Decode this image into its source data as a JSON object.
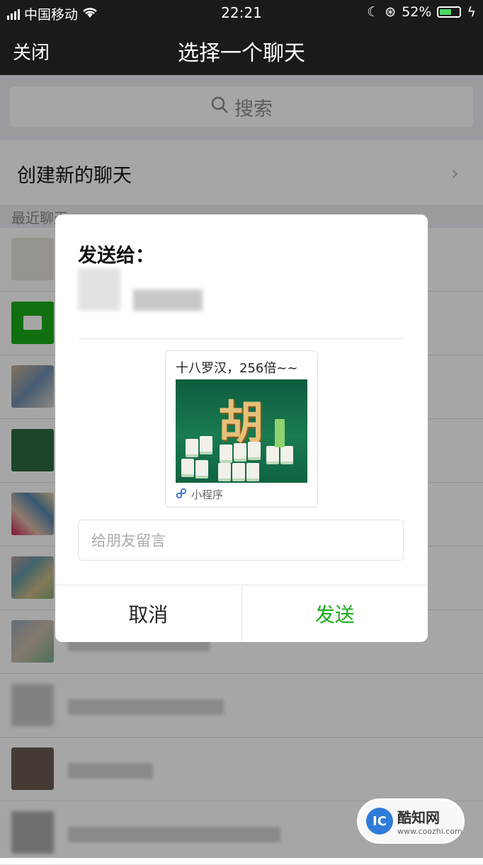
{
  "status_bar": {
    "carrier": "中国移动",
    "time": "22:21",
    "battery": "52%"
  },
  "nav": {
    "close": "关闭",
    "title": "选择一个聊天"
  },
  "search": {
    "placeholder": "搜索"
  },
  "new_chat": {
    "label": "创建新的聊天"
  },
  "recent_label": "最近聊天",
  "dialog": {
    "send_to": "发送给：",
    "card": {
      "title": "十八罗汉，256倍~~",
      "mini_program": "小程序",
      "image_text": "胡"
    },
    "message_placeholder": "给朋友留言",
    "cancel": "取消",
    "send": "发送"
  },
  "watermark": {
    "name": "酷知网",
    "url": "www.coozhi.com"
  },
  "colors": {
    "send_green": "#1aad19",
    "navbar": "#1a1a1a",
    "background": "#efeff4"
  }
}
